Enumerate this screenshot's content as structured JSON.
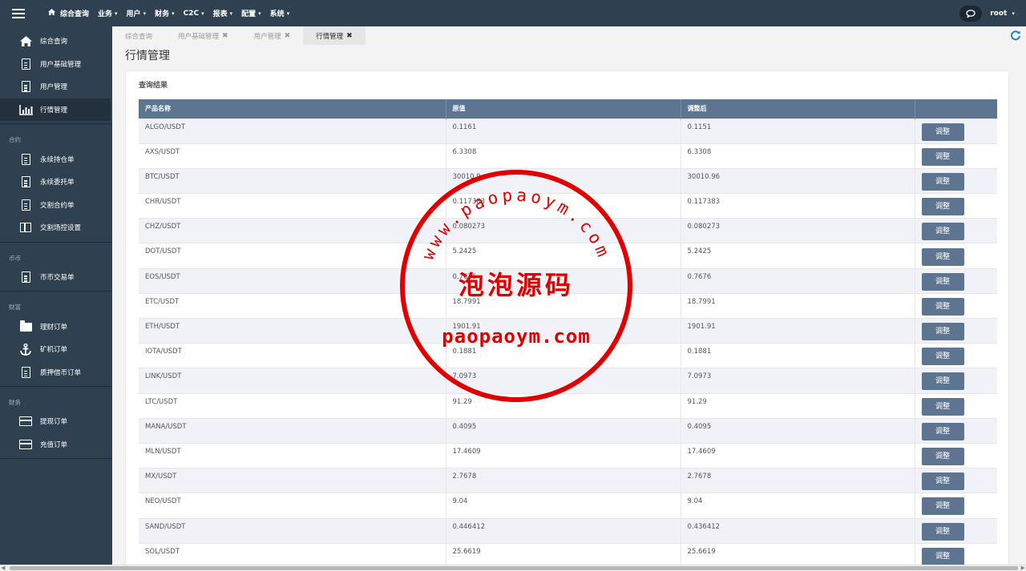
{
  "topbar": {
    "nav": [
      {
        "label": "综合查询",
        "icon": "home-icon",
        "caret": false
      },
      {
        "label": "业务",
        "caret": true
      },
      {
        "label": "用户",
        "caret": true
      },
      {
        "label": "财务",
        "caret": true
      },
      {
        "label": "C2C",
        "caret": true
      },
      {
        "label": "报表",
        "caret": true
      },
      {
        "label": "配置",
        "caret": true
      },
      {
        "label": "系统",
        "caret": true
      }
    ],
    "user": "root",
    "user_caret": "▾"
  },
  "sidebar": {
    "group1": [
      {
        "label": "综合查询",
        "icon": "home-icon"
      },
      {
        "label": "用户基础管理",
        "icon": "document-icon"
      },
      {
        "label": "用户管理",
        "icon": "document-icon"
      },
      {
        "label": "行情管理",
        "icon": "bar-chart-icon",
        "active": true
      }
    ],
    "section_contract": "合约",
    "group2": [
      {
        "label": "永续持仓单",
        "icon": "document-icon"
      },
      {
        "label": "永续委托单",
        "icon": "document-icon"
      },
      {
        "label": "交割合约单",
        "icon": "document-icon"
      },
      {
        "label": "交割场控设置",
        "icon": "columns-icon"
      }
    ],
    "section_coin": "币币",
    "group3": [
      {
        "label": "币币交易单",
        "icon": "document-icon"
      }
    ],
    "section_wealth": "财富",
    "group4": [
      {
        "label": "理财订单",
        "icon": "folder-icon"
      },
      {
        "label": "矿机订单",
        "icon": "anchor-icon"
      },
      {
        "label": "质押借币订单",
        "icon": "document-icon"
      }
    ],
    "section_finance": "财务",
    "group5": [
      {
        "label": "提现订单",
        "icon": "credit-card-icon"
      },
      {
        "label": "充值订单",
        "icon": "credit-card-icon"
      }
    ]
  },
  "tabs": [
    {
      "label": "综合查询",
      "closable": false
    },
    {
      "label": "用户基础管理",
      "closable": true
    },
    {
      "label": "用户管理",
      "closable": true
    },
    {
      "label": "行情管理",
      "closable": true,
      "active": true
    }
  ],
  "page_title": "行情管理",
  "card_title": "查询结果",
  "table": {
    "headers": [
      "产品名称",
      "原值",
      "调整后",
      ""
    ],
    "button_label": "调整",
    "rows": [
      [
        "ALGO/USDT",
        "0.1161",
        "0.1151"
      ],
      [
        "AXS/USDT",
        "6.3308",
        "6.3308"
      ],
      [
        "BTC/USDT",
        "30010.9",
        "30010.96"
      ],
      [
        "CHR/USDT",
        "0.117383",
        "0.117383"
      ],
      [
        "CHZ/USDT",
        "0.080273",
        "0.080273"
      ],
      [
        "DOT/USDT",
        "5.2425",
        "5.2425"
      ],
      [
        "EOS/USDT",
        "0.7676",
        "0.7676"
      ],
      [
        "ETC/USDT",
        "18.7991",
        "18.7991"
      ],
      [
        "ETH/USDT",
        "1901.91",
        "1901.91"
      ],
      [
        "IOTA/USDT",
        "0.1881",
        "0.1881"
      ],
      [
        "LINK/USDT",
        "7.0973",
        "7.0973"
      ],
      [
        "LTC/USDT",
        "91.29",
        "91.29"
      ],
      [
        "MANA/USDT",
        "0.4095",
        "0.4095"
      ],
      [
        "MLN/USDT",
        "17.4609",
        "17.4609"
      ],
      [
        "MX/USDT",
        "2.7678",
        "2.7678"
      ],
      [
        "NEO/USDT",
        "9.04",
        "9.04"
      ],
      [
        "SAND/USDT",
        "0.446412",
        "0.436412"
      ],
      [
        "SOL/USDT",
        "25.6619",
        "25.6619"
      ]
    ]
  },
  "watermark": {
    "arc_text": "www.paopaoym.com",
    "center_text": "泡泡源码",
    "bottom_text": "paopaoym.com",
    "color": "#e00000"
  }
}
